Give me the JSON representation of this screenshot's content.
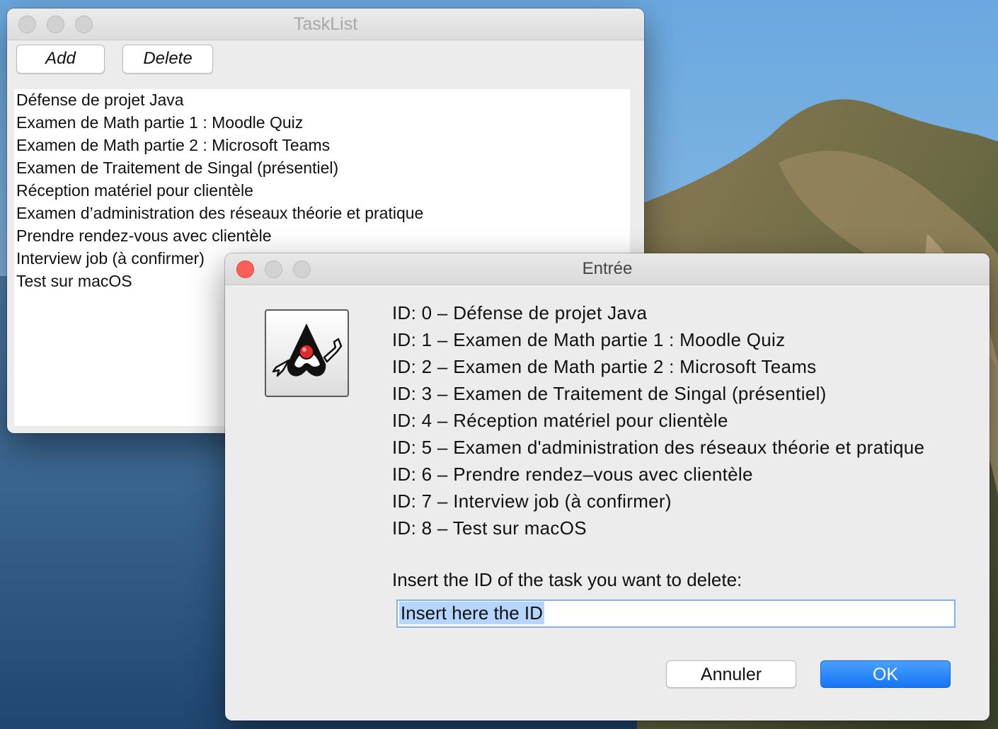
{
  "tasklist_window": {
    "title": "TaskList",
    "add_label": "Add",
    "delete_label": "Delete",
    "items": [
      "Défense de projet Java",
      "Examen de Math partie 1 : Moodle Quiz",
      "Examen de Math partie 2 : Microsoft Teams",
      "Examen de Traitement de Singal (présentiel)",
      "Réception matériel pour clientèle",
      "Examen d’administration des réseaux théorie et pratique",
      "Prendre rendez-vous avec clientèle",
      "Interview job (à confirmer)",
      "Test sur macOS"
    ]
  },
  "dialog": {
    "title": "Entrée",
    "icon": "java-duke-icon",
    "lines": [
      "ID: 0 – Défense de projet Java",
      "ID: 1 – Examen de Math partie 1 : Moodle Quiz",
      "ID: 2 – Examen de Math partie 2 : Microsoft Teams",
      "ID: 3 – Examen de Traitement de Singal (présentiel)",
      "ID: 4 – Réception matériel pour clientèle",
      "ID: 5 – Examen d'administration des réseaux théorie et pratique",
      "ID: 6 – Prendre rendez–vous avec clientèle",
      "ID: 7 – Interview job (à confirmer)",
      "ID: 8 – Test sur macOS"
    ],
    "prompt": "Insert the ID of the task you want to delete:",
    "input_value": "Insert here the ID",
    "cancel_label": "Annuler",
    "ok_label": "OK"
  },
  "colors": {
    "accent": "#1575f4",
    "close": "#fc5f57",
    "selection": "#b5d5fd"
  }
}
